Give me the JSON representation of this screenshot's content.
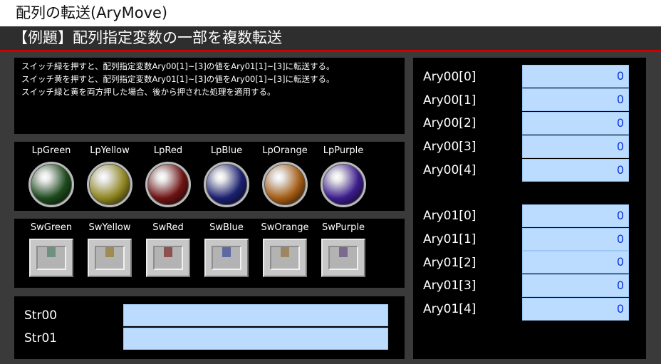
{
  "window": {
    "title": "配列の転送(AryMove)"
  },
  "section": {
    "title": "【例題】配列指定変数の一部を複数転送"
  },
  "description": {
    "lines": [
      "スイッチ緑を押すと、配列指定変数Ary00[1]~[3]の値をAry01[1]~[3]に転送する。",
      "スイッチ黄を押すと、配列指定変数Ary01[1]~[3]の値をAry00[1]~[3]に転送する。",
      "スイッチ緑と黄を両方押した場合、後から押された処理を適用する。"
    ]
  },
  "lamps": [
    {
      "label": "LpGreen",
      "color": "#1d4a1d"
    },
    {
      "label": "LpYellow",
      "color": "#8e8420"
    },
    {
      "label": "LpRed",
      "color": "#6e1313"
    },
    {
      "label": "LpBlue",
      "color": "#1b2070"
    },
    {
      "label": "LpOrange",
      "color": "#a35c14"
    },
    {
      "label": "LpPurple",
      "color": "#3c1d8c"
    }
  ],
  "switches": [
    {
      "label": "SwGreen",
      "color": "#6f8f80"
    },
    {
      "label": "SwYellow",
      "color": "#a08b50"
    },
    {
      "label": "SwRed",
      "color": "#8f5050"
    },
    {
      "label": "SwBlue",
      "color": "#5e69a3"
    },
    {
      "label": "SwOrange",
      "color": "#9f8662"
    },
    {
      "label": "SwPurple",
      "color": "#7b6a90"
    }
  ],
  "strings": [
    {
      "label": "Str00",
      "value": ""
    },
    {
      "label": "Str01",
      "value": ""
    }
  ],
  "ary00": [
    {
      "label": "Ary00[0]",
      "value": "0"
    },
    {
      "label": "Ary00[1]",
      "value": "0"
    },
    {
      "label": "Ary00[2]",
      "value": "0"
    },
    {
      "label": "Ary00[3]",
      "value": "0"
    },
    {
      "label": "Ary00[4]",
      "value": "0"
    }
  ],
  "ary01": [
    {
      "label": "Ary01[0]",
      "value": "0"
    },
    {
      "label": "Ary01[1]",
      "value": "0"
    },
    {
      "label": "Ary01[2]",
      "value": "0"
    },
    {
      "label": "Ary01[3]",
      "value": "0"
    },
    {
      "label": "Ary01[4]",
      "value": "0"
    }
  ]
}
